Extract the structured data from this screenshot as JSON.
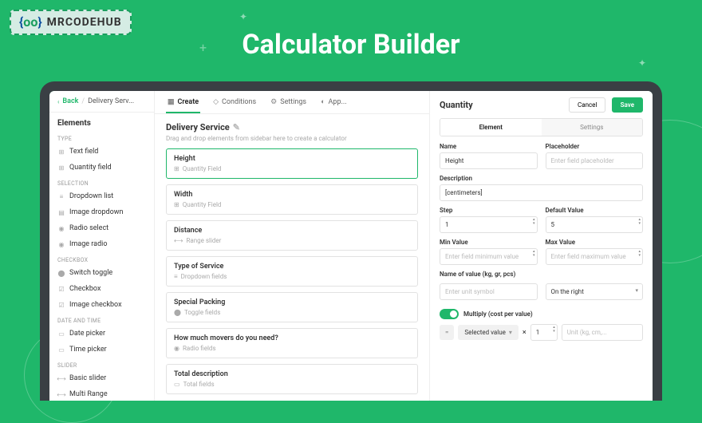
{
  "badge": {
    "icon_left": "{",
    "icon_mid": "oo",
    "icon_right": "}",
    "text": "MRCODEHUB"
  },
  "hero": {
    "title": "Calculator Builder"
  },
  "nav": {
    "back": "Back",
    "crumb": "Delivery Serv..."
  },
  "sidebar": {
    "title": "Elements",
    "groups": [
      {
        "label": "TYPE",
        "items": [
          {
            "icon": "⊞",
            "label": "Text field"
          },
          {
            "icon": "⊞",
            "label": "Quantity field"
          }
        ]
      },
      {
        "label": "SELECTION",
        "items": [
          {
            "icon": "≡",
            "label": "Dropdown list"
          },
          {
            "icon": "▤",
            "label": "Image dropdown"
          },
          {
            "icon": "◉",
            "label": "Radio select"
          },
          {
            "icon": "◉",
            "label": "Image radio"
          }
        ]
      },
      {
        "label": "CHECKBOX",
        "items": [
          {
            "icon": "⬤",
            "label": "Switch toggle"
          },
          {
            "icon": "☑",
            "label": "Checkbox"
          },
          {
            "icon": "☑",
            "label": "Image checkbox"
          }
        ]
      },
      {
        "label": "DATE AND TIME",
        "items": [
          {
            "icon": "▭",
            "label": "Date picker"
          },
          {
            "icon": "▭",
            "label": "Time picker"
          }
        ]
      },
      {
        "label": "SLIDER",
        "items": [
          {
            "icon": "⟷",
            "label": "Basic slider"
          },
          {
            "icon": "⟷",
            "label": "Multi Range"
          }
        ]
      }
    ]
  },
  "tabs": [
    {
      "icon": "▦",
      "label": "Create",
      "active": true
    },
    {
      "icon": "◇",
      "label": "Conditions"
    },
    {
      "icon": "⚙",
      "label": "Settings"
    },
    {
      "icon": "◐",
      "label": "App..."
    }
  ],
  "canvas": {
    "title": "Delivery Service",
    "hint": "Drag and drop elements from sidebar here to create a calculator",
    "fields": [
      {
        "name": "Height",
        "type": "Quantity Field",
        "icon": "⊞",
        "selected": true
      },
      {
        "name": "Width",
        "type": "Quantity Field",
        "icon": "⊞"
      },
      {
        "name": "Distance",
        "type": "Range slider",
        "icon": "⟷"
      },
      {
        "name": "Type of Service",
        "type": "Dropdown fields",
        "icon": "≡"
      },
      {
        "name": "Special Packing",
        "type": "Toggle fields",
        "icon": "⬤"
      },
      {
        "name": "How much movers do you need?",
        "type": "Radio fields",
        "icon": "◉"
      },
      {
        "name": "Total description",
        "type": "Total fields",
        "icon": "▭"
      }
    ]
  },
  "panel": {
    "title": "Quantity",
    "cancel": "Cancel",
    "save": "Save",
    "subtabs": {
      "element": "Element",
      "settings": "Settings"
    },
    "name": {
      "label": "Name",
      "value": "Height"
    },
    "placeholder": {
      "label": "Placeholder",
      "ph": "Enter field placeholder"
    },
    "description": {
      "label": "Description",
      "value": "[centimeters]"
    },
    "step": {
      "label": "Step",
      "value": "1"
    },
    "default": {
      "label": "Default Value",
      "value": "5"
    },
    "min": {
      "label": "Min Value",
      "ph": "Enter field minimum value"
    },
    "max": {
      "label": "Max Value",
      "ph": "Enter field maximum value"
    },
    "unitname": {
      "label": "Name of value (kg, gr, pcs)",
      "ph": "Enter unit symbol"
    },
    "unitpos": {
      "value": "On the right"
    },
    "multiply": {
      "label": "Multiply (cost per value)"
    },
    "formula": {
      "eq": "=",
      "chip": "Selected value",
      "times": "×",
      "factor": "1",
      "unit_ph": "Unit (kg, cm,..."
    }
  }
}
